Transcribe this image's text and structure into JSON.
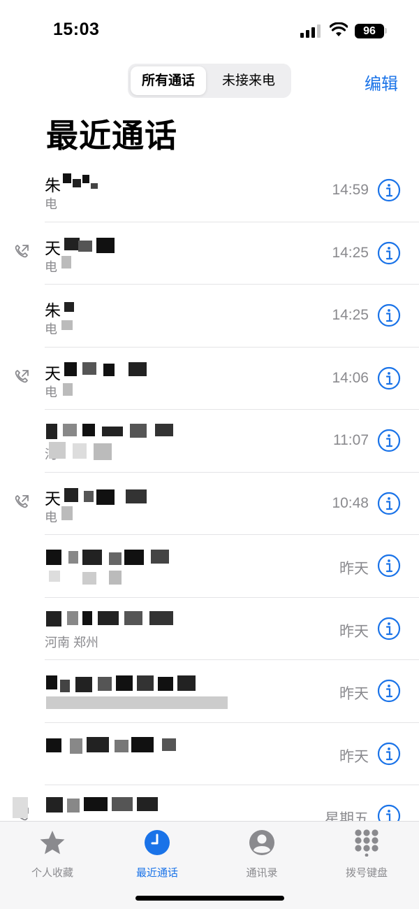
{
  "status_bar": {
    "time": "15:03",
    "battery": "96"
  },
  "segment": {
    "all_label": "所有通话",
    "missed_label": "未接来电"
  },
  "header": {
    "edit_label": "编辑",
    "title": "最近通话"
  },
  "calls": [
    {
      "name": "朱",
      "detail": "电",
      "time": "14:59",
      "outgoing": false
    },
    {
      "name": "天",
      "detail": "电",
      "time": "14:25",
      "outgoing": true
    },
    {
      "name": "朱",
      "detail": "电",
      "time": "14:25",
      "outgoing": false
    },
    {
      "name": "天",
      "detail": "电",
      "time": "14:06",
      "outgoing": true
    },
    {
      "name": "",
      "detail": "河",
      "time": "11:07",
      "outgoing": false
    },
    {
      "name": "天",
      "detail": "电",
      "time": "10:48",
      "outgoing": true
    },
    {
      "name": "",
      "detail": "",
      "time": "昨天",
      "outgoing": false
    },
    {
      "name": "",
      "detail": "河南 郑州",
      "time": "昨天",
      "outgoing": false
    },
    {
      "name": "",
      "detail": "",
      "time": "昨天",
      "outgoing": false
    },
    {
      "name": "",
      "detail": "",
      "time": "昨天",
      "outgoing": false
    },
    {
      "name": "",
      "detail": "",
      "time": "星期五",
      "outgoing": true
    }
  ],
  "tabs": [
    {
      "label": "个人收藏",
      "icon": "star-icon",
      "active": false
    },
    {
      "label": "最近通话",
      "icon": "clock-icon",
      "active": true
    },
    {
      "label": "通讯录",
      "icon": "person-icon",
      "active": false
    },
    {
      "label": "拨号键盘",
      "icon": "keypad-icon",
      "active": false
    }
  ],
  "colors": {
    "accent": "#1a73e8",
    "secondary_text": "#8a8a8e",
    "separator": "#e4e4e6"
  }
}
